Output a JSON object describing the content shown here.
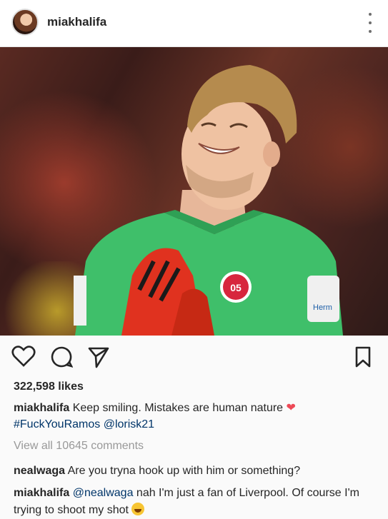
{
  "header": {
    "username": "miakhalifa"
  },
  "post": {
    "likes": "322,598 likes",
    "caption": {
      "user": "miakhalifa",
      "text": " Keep smiling. Mistakes are human nature ",
      "hashtag": "#FuckYouRamos",
      "mention": "@lorisk21"
    },
    "view_all": "View all 10645 comments",
    "comments": [
      {
        "user": "nealwaga",
        "text": " Are you tryna hook up with him or something?"
      },
      {
        "user": "miakhalifa",
        "mention": "@nealwaga",
        "text": " nah I'm just a fan of Liverpool. Of course I'm trying to shoot my shot "
      }
    ]
  },
  "photo": {
    "jersey_badge_text": "05",
    "sleeve_text": "Herm"
  },
  "colors": {
    "link": "#003569",
    "heart": "#ed4956",
    "muted": "#999999"
  }
}
